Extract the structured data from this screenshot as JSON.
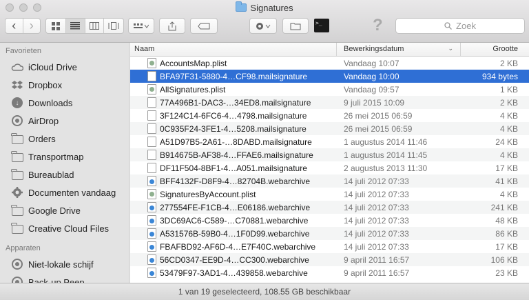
{
  "window": {
    "title": "Signatures"
  },
  "toolbar": {
    "back": "‹",
    "forward": "›",
    "search_placeholder": "Zoek",
    "help": "?"
  },
  "sidebar": {
    "favorites_label": "Favorieten",
    "devices_label": "Apparaten",
    "favorites": [
      {
        "label": "iCloud Drive",
        "icon": "cloud-icon"
      },
      {
        "label": "Dropbox",
        "icon": "dropbox-icon"
      },
      {
        "label": "Downloads",
        "icon": "downloads-icon"
      },
      {
        "label": "AirDrop",
        "icon": "airdrop-icon"
      },
      {
        "label": "Orders",
        "icon": "folder-icon"
      },
      {
        "label": "Transportmap",
        "icon": "folder-icon"
      },
      {
        "label": "Bureaublad",
        "icon": "folder-icon"
      },
      {
        "label": "Documenten vandaag",
        "icon": "gear-icon"
      },
      {
        "label": "Google Drive",
        "icon": "folder-icon"
      },
      {
        "label": "Creative Cloud Files",
        "icon": "folder-icon"
      }
    ],
    "devices": [
      {
        "label": "Niet-lokale schijf",
        "icon": "disc-icon"
      },
      {
        "label": "Back-up Peep",
        "icon": "clock-icon"
      }
    ]
  },
  "list": {
    "headers": {
      "name": "Naam",
      "date": "Bewerkingsdatum",
      "size": "Grootte"
    },
    "rows": [
      {
        "name": "AccountsMap.plist",
        "date": "Vandaag 10:07",
        "size": "2 KB",
        "type": "plist"
      },
      {
        "name": "BFA97F31-5880-4…CF98.mailsignature",
        "date": "Vandaag 10:00",
        "size": "934 bytes",
        "type": "doc"
      },
      {
        "name": "AllSignatures.plist",
        "date": "Vandaag 09:57",
        "size": "1 KB",
        "type": "plist"
      },
      {
        "name": "77A496B1-DAC3-…34ED8.mailsignature",
        "date": "9 juli 2015 10:09",
        "size": "2 KB",
        "type": "doc"
      },
      {
        "name": "3F124C14-6FC6-4…4798.mailsignature",
        "date": "26 mei 2015 06:59",
        "size": "4 KB",
        "type": "doc"
      },
      {
        "name": "0C935F24-3FE1-4…5208.mailsignature",
        "date": "26 mei 2015 06:59",
        "size": "4 KB",
        "type": "doc"
      },
      {
        "name": "A51D97B5-2A61-…8DABD.mailsignature",
        "date": "1 augustus 2014 11:46",
        "size": "24 KB",
        "type": "doc"
      },
      {
        "name": "B914675B-AF38-4…FFAE6.mailsignature",
        "date": "1 augustus 2014 11:45",
        "size": "4 KB",
        "type": "doc"
      },
      {
        "name": "DF11F504-8BF1-4…A051.mailsignature",
        "date": "2 augustus 2013 11:30",
        "size": "17 KB",
        "type": "doc"
      },
      {
        "name": "BFF4132F-D8F9-4…82704B.webarchive",
        "date": "14 juli 2012 07:33",
        "size": "41 KB",
        "type": "web"
      },
      {
        "name": "SignaturesByAccount.plist",
        "date": "14 juli 2012 07:33",
        "size": "4 KB",
        "type": "plist"
      },
      {
        "name": "277554FE-F1CB-4…E06186.webarchive",
        "date": "14 juli 2012 07:33",
        "size": "241 KB",
        "type": "web"
      },
      {
        "name": "3DC69AC6-C589-…C70881.webarchive",
        "date": "14 juli 2012 07:33",
        "size": "48 KB",
        "type": "web"
      },
      {
        "name": "A531576B-59B0-4…1F0D99.webarchive",
        "date": "14 juli 2012 07:33",
        "size": "86 KB",
        "type": "web"
      },
      {
        "name": "FBAFBD92-AF6D-4…E7F40C.webarchive",
        "date": "14 juli 2012 07:33",
        "size": "17 KB",
        "type": "web"
      },
      {
        "name": "56CD0347-EE9D-4…CC300.webarchive",
        "date": "9 april 2011 16:57",
        "size": "106 KB",
        "type": "web"
      },
      {
        "name": "53479F97-3AD1-4…439858.webarchive",
        "date": "9 april 2011 16:57",
        "size": "23 KB",
        "type": "web"
      }
    ]
  },
  "status": {
    "text": "1 van 19 geselecteerd, 108.55 GB beschikbaar"
  },
  "colors": {
    "selection": "#2f6fd5",
    "folder_accent": "#7fb7e8"
  }
}
